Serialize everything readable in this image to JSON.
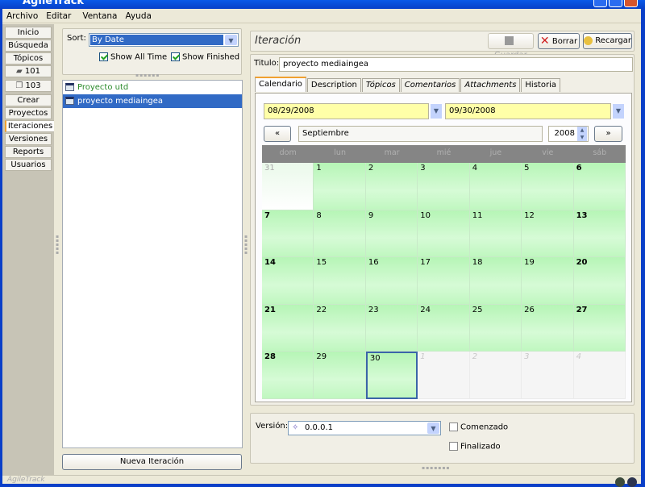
{
  "window": {
    "title": "AgileTrack"
  },
  "menu": [
    "Archivo",
    "Editar",
    "Ventana",
    "Ayuda"
  ],
  "nav": [
    {
      "label": "Inicio"
    },
    {
      "label": "Búsqueda"
    },
    {
      "label": "Tópicos"
    },
    {
      "label": "101",
      "icon": "book-icon"
    },
    {
      "label": "103",
      "icon": "pages-icon"
    },
    {
      "label": "Crear"
    },
    {
      "label": "Proyectos"
    },
    {
      "label": "Iteraciones",
      "selected": true
    },
    {
      "label": "Versiones"
    },
    {
      "label": "Reports"
    },
    {
      "label": "Usuarios"
    }
  ],
  "list_panel": {
    "sort_label": "Sort:",
    "sort_value": "By Date",
    "show_all_time": "Show All Time",
    "show_finished": "Show Finished",
    "items": [
      {
        "label": "Proyecto utd",
        "color": "#2a8a2a"
      },
      {
        "label": "proyecto mediaingea",
        "selected": true
      }
    ],
    "new_button": "Nueva Iteración"
  },
  "detail": {
    "header": "Iteración",
    "guardar": "Guardar",
    "borrar": "Borrar",
    "recargar": "Recargar",
    "titulo_label": "Titulo:",
    "titulo_value": "proyecto mediaingea",
    "tabs": [
      {
        "label": "Calendario",
        "selected": true
      },
      {
        "label": "Description"
      },
      {
        "label": "Tópicos",
        "italic": true
      },
      {
        "label": "Comentarios",
        "italic": true
      },
      {
        "label": "Attachments",
        "italic": true
      },
      {
        "label": "Historia"
      }
    ],
    "start_date": "08/29/2008",
    "end_date": "09/30/2008",
    "prev": "«",
    "next": "»",
    "month": "Septiembre",
    "year": "2008",
    "weekdays": [
      "dom",
      "lun",
      "mar",
      "mié",
      "jue",
      "vie",
      "sáb"
    ],
    "days": [
      {
        "d": "31",
        "t": "first"
      },
      {
        "d": "1"
      },
      {
        "d": "2"
      },
      {
        "d": "3"
      },
      {
        "d": "4"
      },
      {
        "d": "5"
      },
      {
        "d": "6"
      },
      {
        "d": "7"
      },
      {
        "d": "8"
      },
      {
        "d": "9"
      },
      {
        "d": "10"
      },
      {
        "d": "11"
      },
      {
        "d": "12"
      },
      {
        "d": "13"
      },
      {
        "d": "14"
      },
      {
        "d": "15"
      },
      {
        "d": "16"
      },
      {
        "d": "17"
      },
      {
        "d": "18"
      },
      {
        "d": "19"
      },
      {
        "d": "20"
      },
      {
        "d": "21"
      },
      {
        "d": "22"
      },
      {
        "d": "23"
      },
      {
        "d": "24"
      },
      {
        "d": "25"
      },
      {
        "d": "26"
      },
      {
        "d": "27"
      },
      {
        "d": "28"
      },
      {
        "d": "29"
      },
      {
        "d": "30",
        "t": "today"
      },
      {
        "d": "1",
        "t": "other"
      },
      {
        "d": "2",
        "t": "other"
      },
      {
        "d": "3",
        "t": "other"
      },
      {
        "d": "4",
        "t": "other"
      }
    ],
    "version_label": "Versión:",
    "version_value": "0.0.0.1",
    "comenzado": "Comenzado",
    "finalizado": "Finalizado"
  },
  "status": {
    "app": "AgileTrack"
  }
}
